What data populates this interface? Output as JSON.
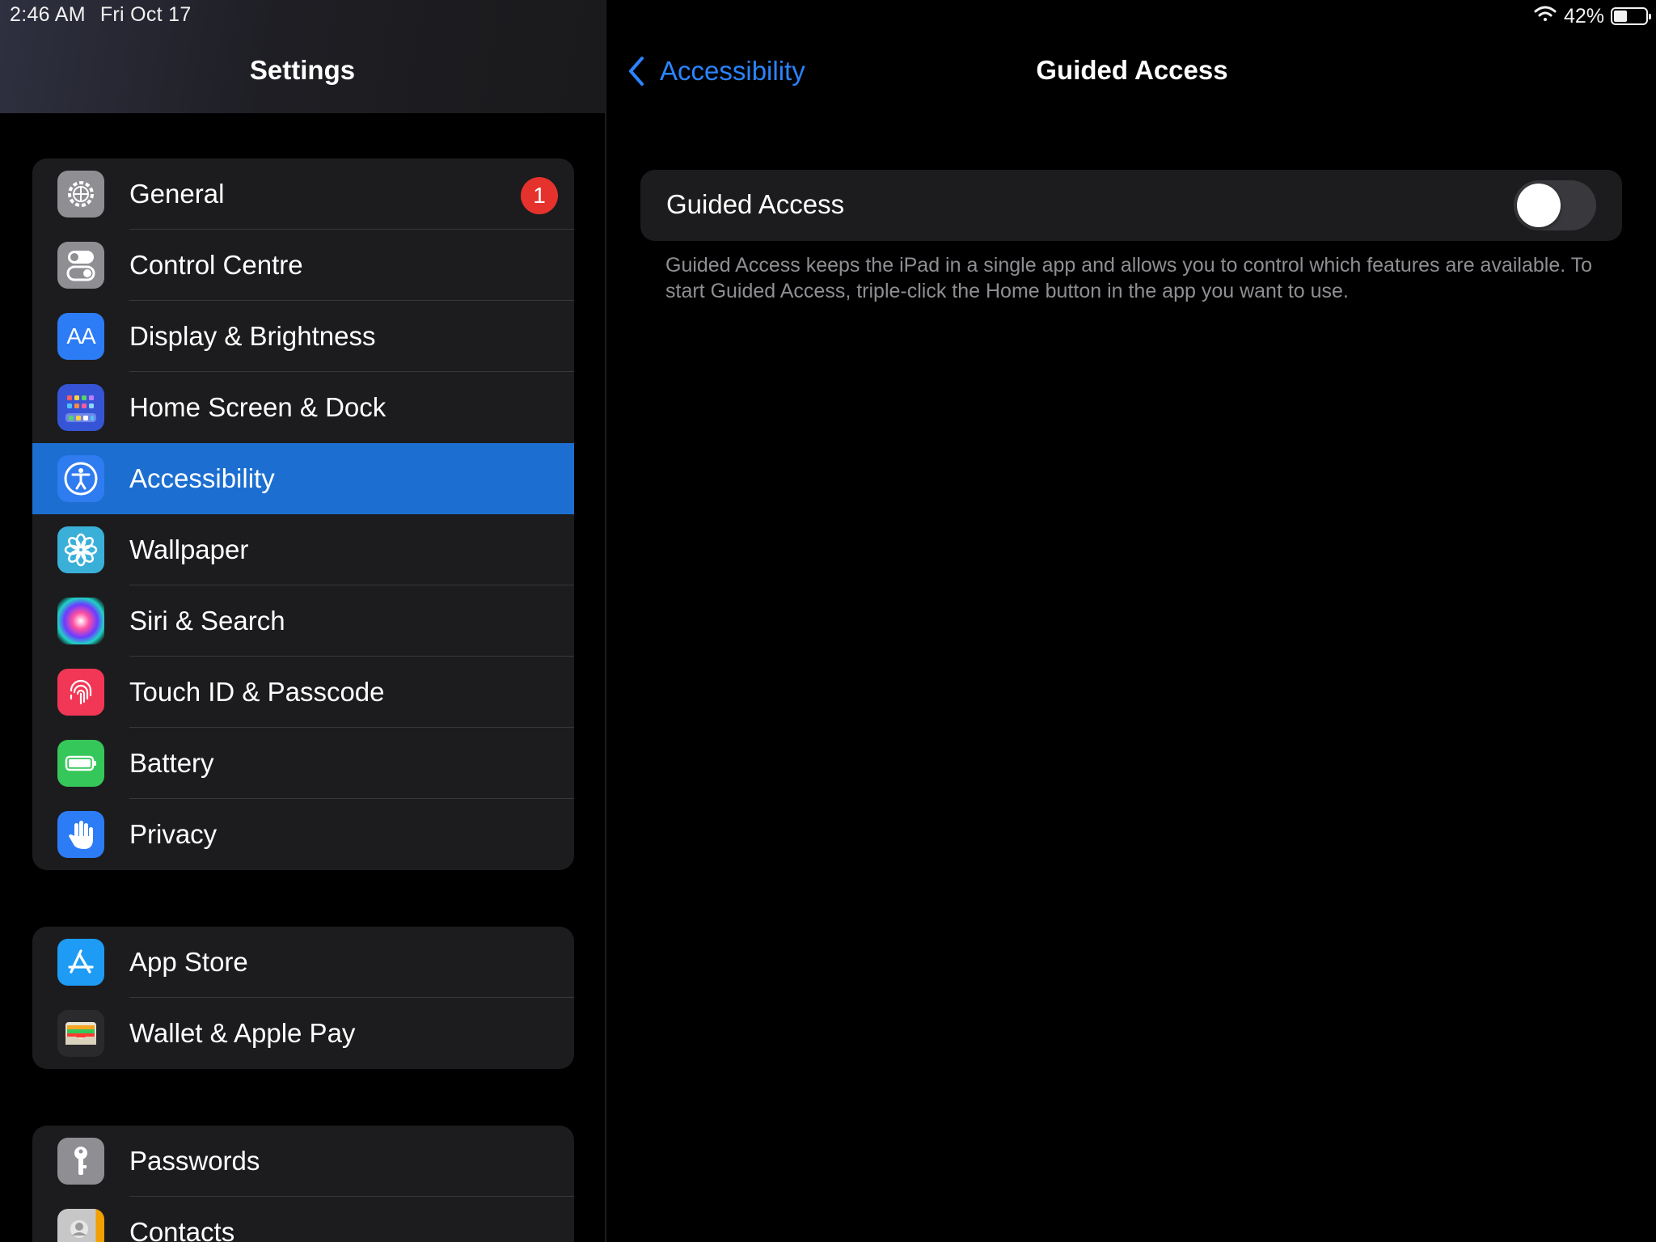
{
  "status_bar": {
    "time": "2:46 AM",
    "date": "Fri Oct 17",
    "battery_percent": "42%",
    "battery_level": 0.42
  },
  "sidebar": {
    "title": "Settings",
    "groups": [
      {
        "items": [
          {
            "label": "General",
            "icon": "gear-icon",
            "badge": "1",
            "color": "#8e8e93"
          },
          {
            "label": "Control Centre",
            "icon": "switches-icon",
            "color": "#8e8e93"
          },
          {
            "label": "Display & Brightness",
            "icon": "text-size-icon",
            "color": "#2c7cf6"
          },
          {
            "label": "Home Screen & Dock",
            "icon": "app-grid-icon",
            "color": "#3655d6"
          },
          {
            "label": "Accessibility",
            "icon": "accessibility-icon",
            "color": "#2f7bf0",
            "selected": true
          },
          {
            "label": "Wallpaper",
            "icon": "flower-icon",
            "color": "#3ab0d9"
          },
          {
            "label": "Siri & Search",
            "icon": "siri-icon",
            "color": "#1a1a2e"
          },
          {
            "label": "Touch ID & Passcode",
            "icon": "fingerprint-icon",
            "color": "#f23756"
          },
          {
            "label": "Battery",
            "icon": "battery-icon",
            "color": "#35c759"
          },
          {
            "label": "Privacy",
            "icon": "hand-icon",
            "color": "#2c7cf6"
          }
        ]
      },
      {
        "items": [
          {
            "label": "App Store",
            "icon": "app-store-icon",
            "color": "#1e9cf5"
          },
          {
            "label": "Wallet & Apple Pay",
            "icon": "wallet-icon",
            "color": "#2a2a2c"
          }
        ]
      },
      {
        "items": [
          {
            "label": "Passwords",
            "icon": "key-icon",
            "color": "#8e8e93"
          },
          {
            "label": "Contacts",
            "icon": "contacts-icon",
            "color": "#bdbdbd"
          }
        ]
      }
    ]
  },
  "detail": {
    "back_label": "Accessibility",
    "title": "Guided Access",
    "setting_label": "Guided Access",
    "toggle_on": false,
    "footnote": "Guided Access keeps the iPad in a single app and allows you to control which features are available. To start Guided Access, triple-click the Home button in the app you want to use.",
    "accent_color": "#2a84ff"
  }
}
